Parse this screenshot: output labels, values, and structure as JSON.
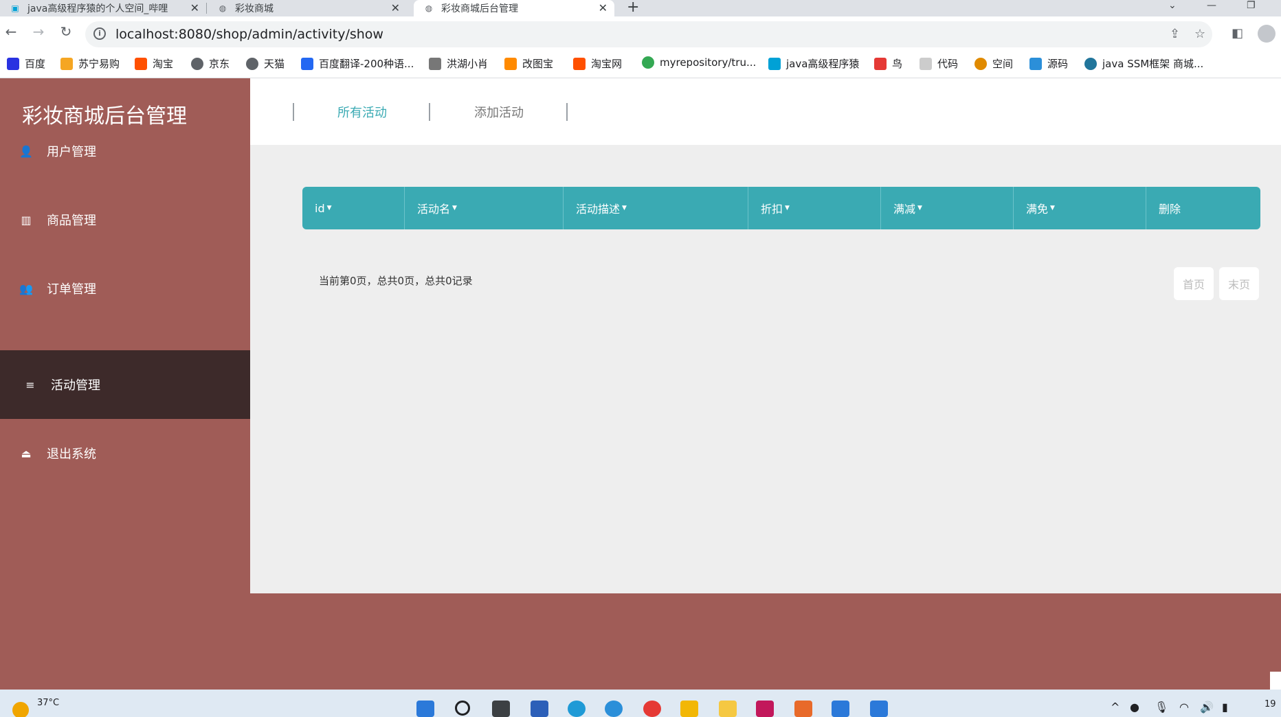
{
  "browser": {
    "tabs": [
      {
        "title": "java高级程序猿的个人空间_哔哩",
        "active": false
      },
      {
        "title": "彩妆商城",
        "active": false
      },
      {
        "title": "彩妆商城后台管理",
        "active": true
      }
    ],
    "new_tab_label": "+",
    "url": "localhost:8080/shop/admin/activity/show",
    "bookmarks": [
      {
        "label": "百度",
        "color": "#2932e1"
      },
      {
        "label": "苏宁易购",
        "color": "#f5a623"
      },
      {
        "label": "淘宝",
        "color": "#ff5000"
      },
      {
        "label": "京东",
        "color": "#5f6368"
      },
      {
        "label": "天猫",
        "color": "#5f6368"
      },
      {
        "label": "百度翻译-200种语...",
        "color": "#2468f2"
      },
      {
        "label": "洪湖小肖",
        "color": "#777777"
      },
      {
        "label": "改图宝",
        "color": "#ff8a00"
      },
      {
        "label": "淘宝网",
        "color": "#ff5000"
      },
      {
        "label": "myrepository/tru...",
        "color": "#34a853"
      },
      {
        "label": "java高级程序猿",
        "color": "#00a1d6"
      },
      {
        "label": "鸟",
        "color": "#e53935"
      },
      {
        "label": "代码",
        "color": "#cccccc"
      },
      {
        "label": "空间",
        "color": "#e08a00"
      },
      {
        "label": "源码",
        "color": "#2b8fd9"
      },
      {
        "label": "java SSM框架 商城...",
        "color": "#21759b"
      }
    ]
  },
  "sidebar": {
    "brand": "彩妆商城后台管理",
    "items": [
      {
        "label": "用户管理",
        "icon": "user-icon",
        "glyph": "👤",
        "active": false
      },
      {
        "label": "商品管理",
        "icon": "bar-chart-icon",
        "glyph": "▥",
        "active": false
      },
      {
        "label": "订单管理",
        "icon": "users-icon",
        "glyph": "👥",
        "active": false
      },
      {
        "label": "活动管理",
        "icon": "database-icon",
        "glyph": "≡",
        "active": true
      },
      {
        "label": "退出系统",
        "icon": "eject-icon",
        "glyph": "⏏",
        "active": false
      }
    ]
  },
  "topnav": {
    "links": [
      {
        "label": "所有活动",
        "active": true
      },
      {
        "label": "添加活动",
        "active": false
      }
    ],
    "accent": "#3aaab3"
  },
  "table": {
    "columns": [
      "id",
      "活动名",
      "活动描述",
      "折扣",
      "满减",
      "满免",
      "删除"
    ],
    "sortable": [
      true,
      true,
      true,
      true,
      true,
      true,
      false
    ],
    "rows": []
  },
  "pagination": {
    "info": "当前第0页，总共0页，总共0记录",
    "first_label": "首页",
    "last_label": "末页"
  },
  "taskbar": {
    "temperature": "37°C",
    "clock": "19"
  },
  "colors": {
    "sidebar_bg": "#a05c57",
    "sidebar_active": "#3d2a2a",
    "table_header": "#3aaab3",
    "content_bg": "#eeeeee"
  }
}
